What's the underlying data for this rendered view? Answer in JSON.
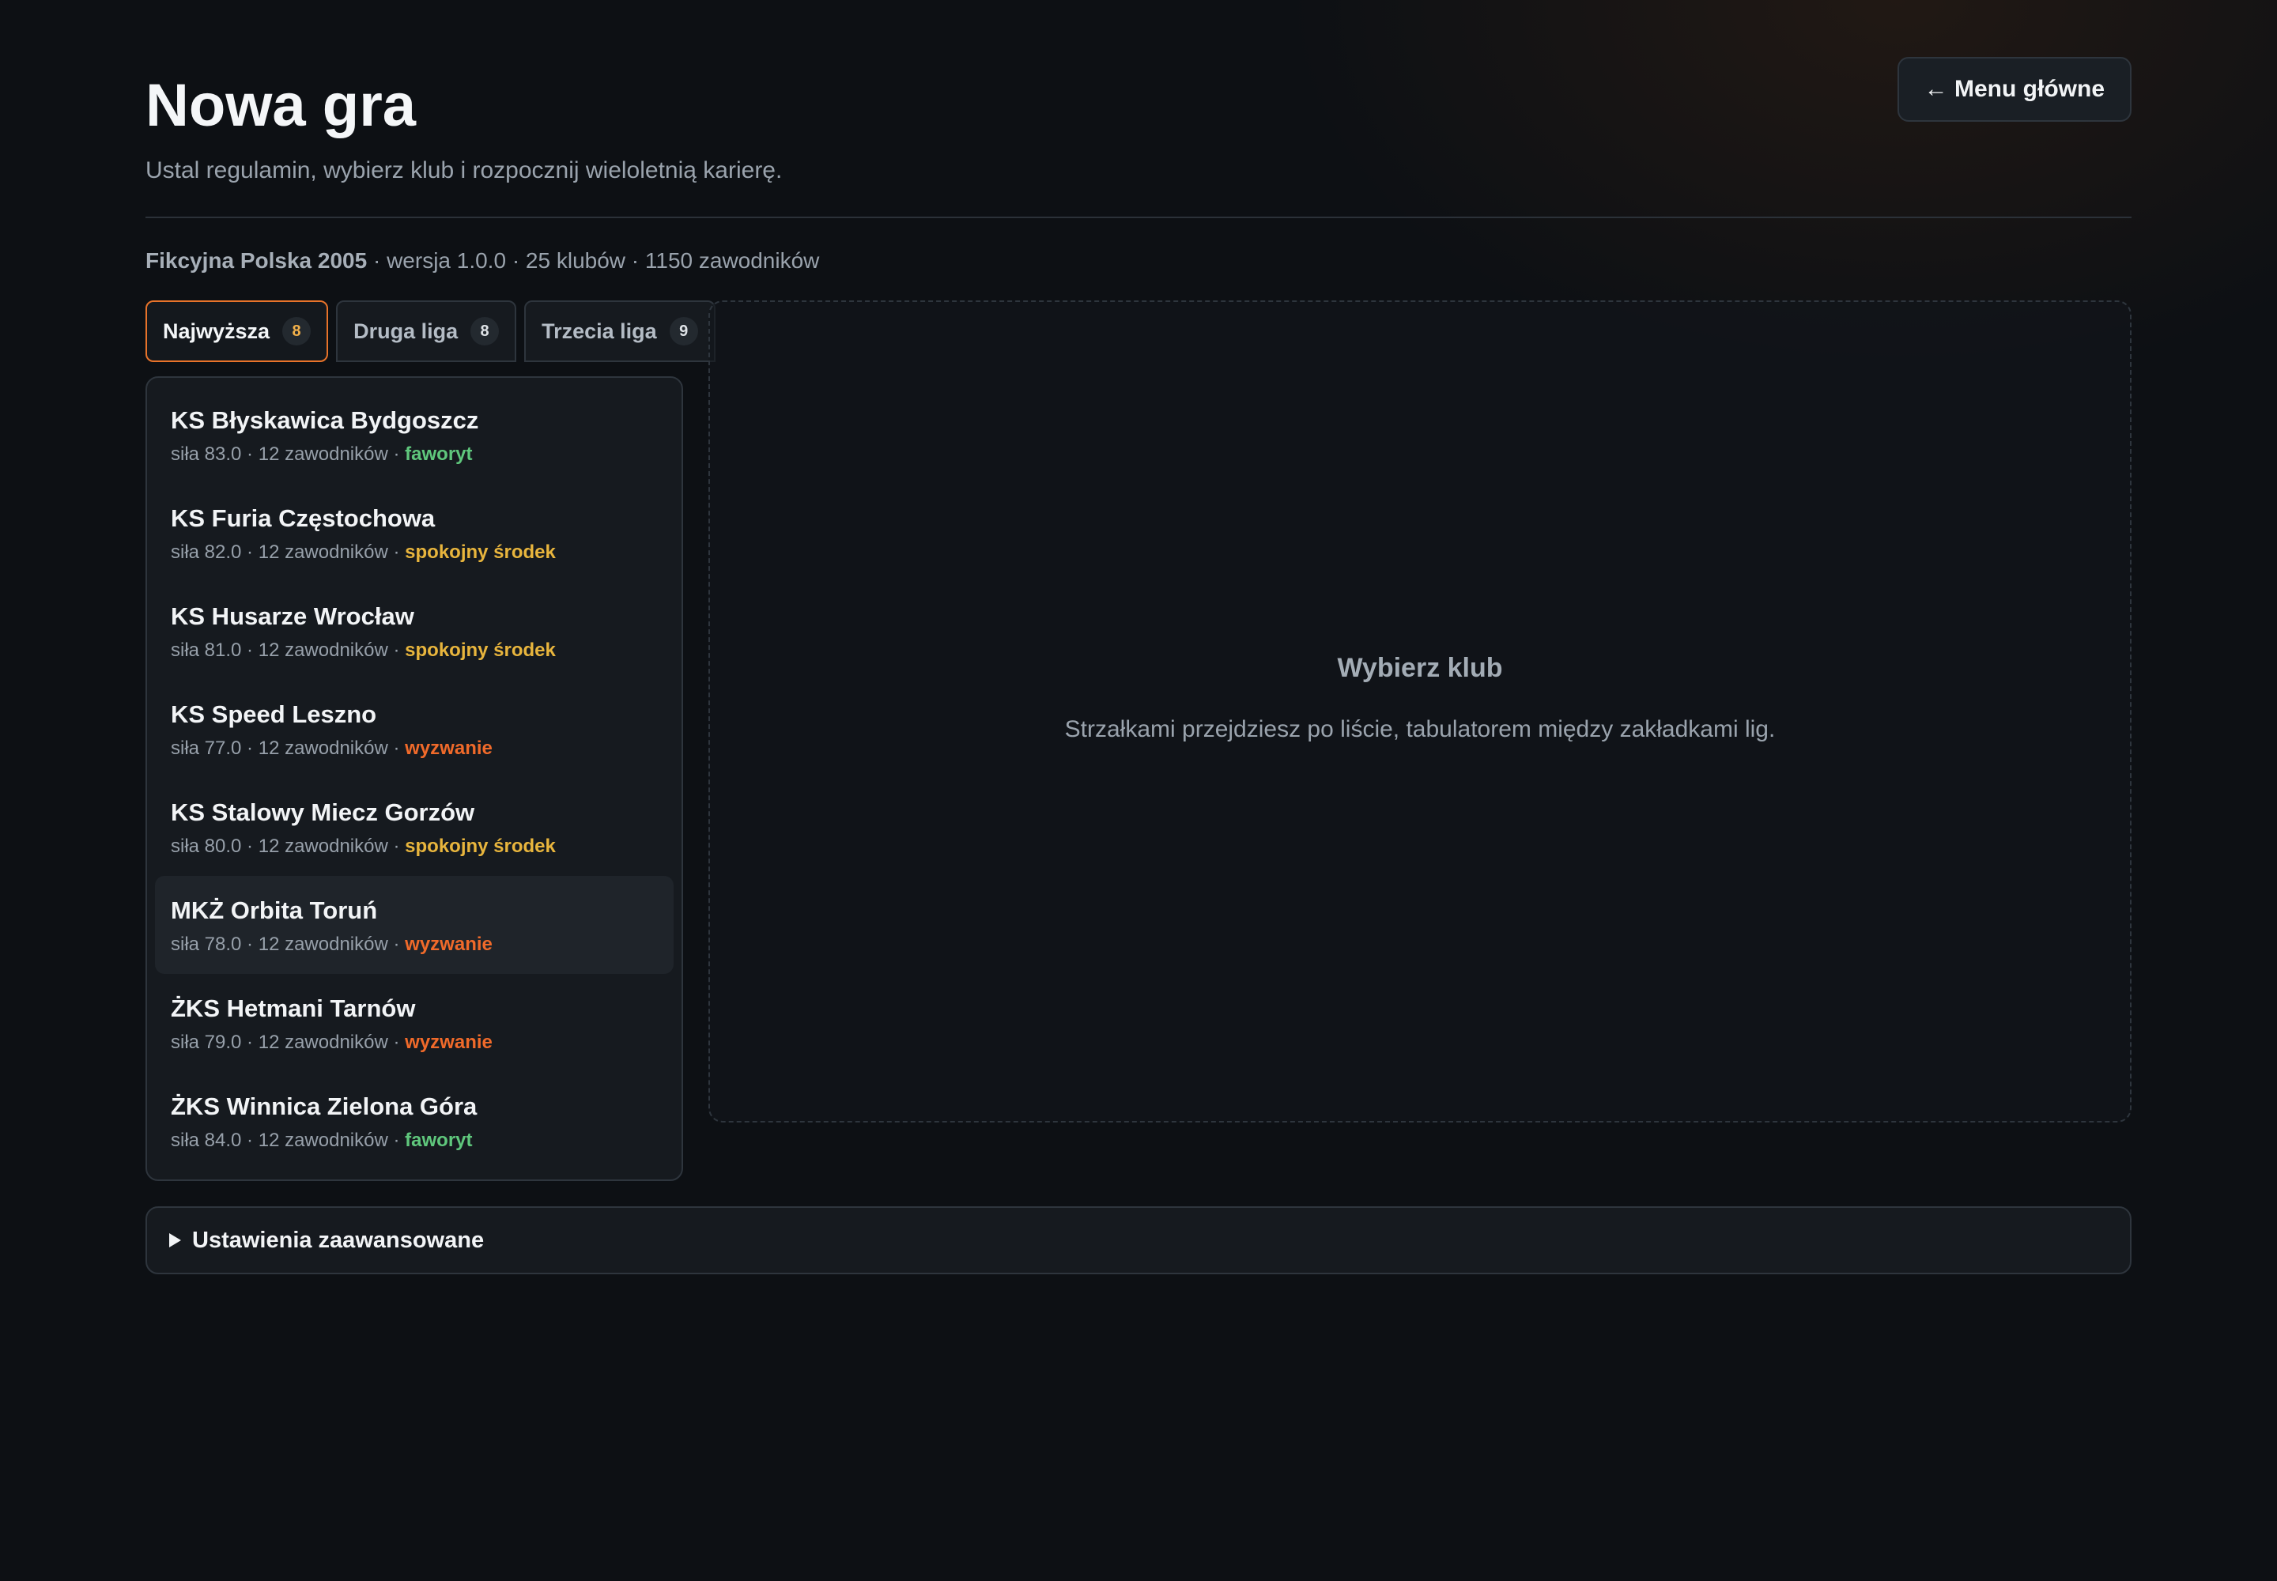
{
  "header": {
    "title": "Nowa gra",
    "subtitle": "Ustal regulamin, wybierz klub i rozpocznij wieloletnią karierę.",
    "menu_button": "← Menu główne"
  },
  "meta": {
    "database": "Fikcyjna Polska 2005",
    "details": " · wersja 1.0.0 · 25 klubów · 1150 zawodników"
  },
  "tabs": [
    {
      "label": "Najwyższa",
      "count": "8",
      "active": true
    },
    {
      "label": "Druga liga",
      "count": "8",
      "active": false
    },
    {
      "label": "Trzecia liga",
      "count": "9",
      "active": false
    }
  ],
  "clubs": [
    {
      "name": "KS Błyskawica Bydgoszcz",
      "info": "siła 83.0 · 12 zawodników · ",
      "tag": "faworyt"
    },
    {
      "name": "KS Furia Częstochowa",
      "info": "siła 82.0 · 12 zawodników · ",
      "tag": "spokojny środek"
    },
    {
      "name": "KS Husarze Wrocław",
      "info": "siła 81.0 · 12 zawodników · ",
      "tag": "spokojny środek"
    },
    {
      "name": "KS Speed Leszno",
      "info": "siła 77.0 · 12 zawodników · ",
      "tag": "wyzwanie"
    },
    {
      "name": "KS Stalowy Miecz Gorzów",
      "info": "siła 80.0 · 12 zawodników · ",
      "tag": "spokojny środek"
    },
    {
      "name": "MKŻ Orbita Toruń",
      "info": "siła 78.0 · 12 zawodników · ",
      "tag": "wyzwanie"
    },
    {
      "name": "ŻKS Hetmani Tarnów",
      "info": "siła 79.0 · 12 zawodników · ",
      "tag": "wyzwanie"
    },
    {
      "name": "ŻKS Winnica Zielona Góra",
      "info": "siła 84.0 · 12 zawodników · ",
      "tag": "faworyt"
    }
  ],
  "tag_colors": {
    "faworyt": "#5fc77c",
    "spokojny środek": "#e8b53d",
    "wyzwanie": "#f06a2a"
  },
  "detail": {
    "title": "Wybierz klub",
    "hint": "Strzałkami przejdziesz po liście, tabulatorem między zakładkami lig."
  },
  "advanced": {
    "label": "Ustawienia zaawansowane",
    "icon": "triangle-right-icon"
  }
}
